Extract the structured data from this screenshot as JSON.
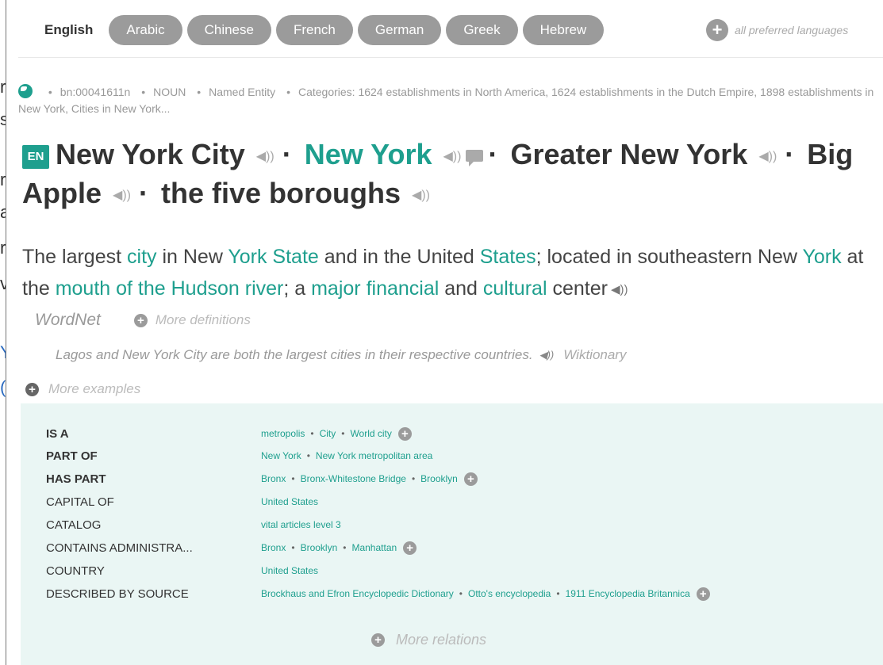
{
  "side_fragments": [
    "r",
    "s",
    "r",
    "a",
    "r",
    "v",
    "Y,",
    "(A"
  ],
  "languages": {
    "active": "English",
    "tabs": [
      "Arabic",
      "Chinese",
      "French",
      "German",
      "Greek",
      "Hebrew"
    ],
    "more_label": "all preferred languages"
  },
  "meta": {
    "id": "bn:00041611n",
    "pos": "NOUN",
    "type": "Named Entity",
    "categories": "Categories: 1624 establishments in North America, 1624 establishments in the Dutch Empire, 1898 establishments in New York, Cities in New York..."
  },
  "title": {
    "badge": "EN",
    "names": [
      "New York City",
      "New York",
      "Greater New York",
      "Big Apple",
      "the five boroughs"
    ]
  },
  "definition": {
    "segments": [
      [
        "The largest ",
        false
      ],
      [
        "city",
        true
      ],
      [
        " in New ",
        false
      ],
      [
        "York State",
        true
      ],
      [
        " and in the United ",
        false
      ],
      [
        "States",
        true
      ],
      [
        "; located in southeastern New ",
        false
      ],
      [
        "York",
        true
      ],
      [
        " at the ",
        false
      ],
      [
        "mouth of the Hudson river",
        true
      ],
      [
        "; a ",
        false
      ],
      [
        "major financial",
        true
      ],
      [
        " and ",
        false
      ],
      [
        "cultural",
        true
      ],
      [
        " center",
        false
      ]
    ],
    "source": "WordNet",
    "more_label": "More definitions"
  },
  "example": {
    "text": "Lagos and New York City are both the largest cities in their respective countries.",
    "source": "Wiktionary",
    "more_label": "More examples"
  },
  "relations": {
    "rows": [
      {
        "label": "IS A",
        "bold": true,
        "values": [
          "metropolis",
          "City",
          "World city"
        ],
        "more": true
      },
      {
        "label": "PART OF",
        "bold": true,
        "values": [
          "New York",
          "New York metropolitan area"
        ],
        "more": false
      },
      {
        "label": "HAS PART",
        "bold": true,
        "values": [
          "Bronx",
          "Bronx-Whitestone Bridge",
          "Brooklyn"
        ],
        "more": true
      },
      {
        "label": "CAPITAL OF",
        "bold": false,
        "values": [
          "United States"
        ],
        "more": false
      },
      {
        "label": "CATALOG",
        "bold": false,
        "values": [
          "vital articles level 3"
        ],
        "more": false
      },
      {
        "label": "CONTAINS ADMINISTRA...",
        "bold": false,
        "values": [
          "Bronx",
          "Brooklyn",
          "Manhattan"
        ],
        "more": true
      },
      {
        "label": "COUNTRY",
        "bold": false,
        "values": [
          "United States"
        ],
        "more": false
      },
      {
        "label": "DESCRIBED BY SOURCE",
        "bold": false,
        "values": [
          "Brockhaus and Efron Encyclopedic Dictionary",
          "Otto's encyclopedia",
          "1911 Encyclopedia Britannica"
        ],
        "more": true
      }
    ],
    "more_label": "More relations"
  },
  "colors": {
    "accent": "#1e9f8e",
    "pill": "#9b9b9b",
    "relations_bg": "#eaf6f4"
  }
}
